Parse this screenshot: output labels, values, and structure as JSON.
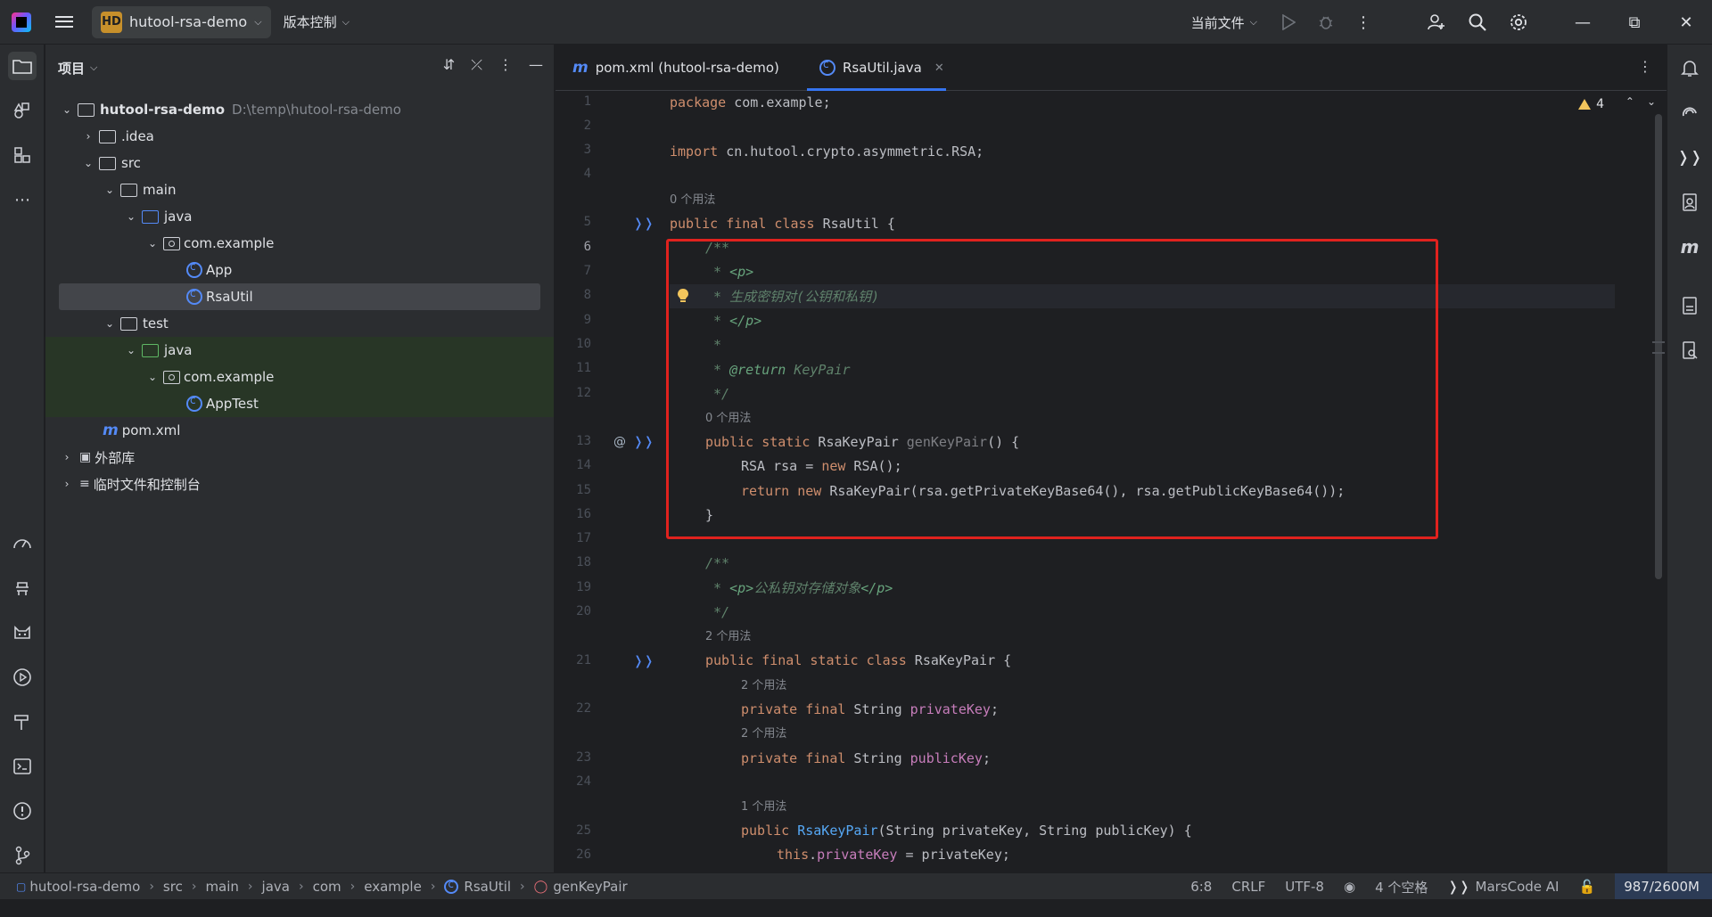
{
  "titlebar": {
    "project_badge": "HD",
    "project_name": "hutool-rsa-demo",
    "vcs_label": "版本控制",
    "run_config": "当前文件"
  },
  "project_panel": {
    "title": "项目",
    "tree": {
      "root_name": "hutool-rsa-demo",
      "root_path": "D:\\temp\\hutool-rsa-demo",
      "idea": ".idea",
      "src": "src",
      "main": "main",
      "java_main": "java",
      "pkg_main": "com.example",
      "app": "App",
      "rsautil": "RsaUtil",
      "test": "test",
      "java_test": "java",
      "pkg_test": "com.example",
      "apptest": "AppTest",
      "pom": "pom.xml",
      "ext_libs": "外部库",
      "scratches": "临时文件和控制台"
    }
  },
  "editor": {
    "tabs": [
      {
        "label": "pom.xml (hutool-rsa-demo)"
      },
      {
        "label": "RsaUtil.java"
      }
    ],
    "warning_count": "4",
    "hints": {
      "h0": "0 个用法",
      "h1": "0 个用法",
      "h2": "2 个用法",
      "h3": "2 个用法",
      "h4": "2 个用法",
      "h5": "1 个用法"
    },
    "line_numbers": [
      "1",
      "2",
      "3",
      "4",
      "5",
      "6",
      "7",
      "8",
      "9",
      "10",
      "11",
      "12",
      "13",
      "14",
      "15",
      "16",
      "17",
      "18",
      "19",
      "20",
      "21",
      "22",
      "23",
      "24",
      "25",
      "26"
    ],
    "code": {
      "l1_kw": "package",
      "l1_rest": " com.example;",
      "l3_kw": "import",
      "l3_rest": " cn.hutool.crypto.asymmetric.RSA;",
      "l5_kw": "public final class",
      "l5_name": " RsaUtil",
      "l5_rest": " {",
      "l6": "/**",
      "l7_star": " * ",
      "l7_tag": "<p>",
      "l8": " * 生成密钥对(公钥和私钥)",
      "l9_star": " * ",
      "l9_tag": "</p>",
      "l10": " *",
      "l11_star": " * ",
      "l11_tag": "@return",
      "l11_ref": " KeyPair",
      "l12": " */",
      "l13_kw": "public static",
      "l13_type": " RsaKeyPair ",
      "l13_fn": "genKeyPair",
      "l13_rest": "() {",
      "l14_a": "RSA rsa = ",
      "l14_kw": "new",
      "l14_b": " RSA();",
      "l15_kw": "return new",
      "l15_rest": " RsaKeyPair(rsa.getPrivateKeyBase64(), rsa.getPublicKeyBase64());",
      "l16": "}",
      "l18": "/**",
      "l19_star": " * ",
      "l19_tag": "<p>",
      "l19_text": "公私钥对存储对象",
      "l19_tag2": "</p>",
      "l20": " */",
      "l21_kw": "public final static class",
      "l21_rest": " RsaKeyPair {",
      "l22_kw": "private final",
      "l22_type": " String ",
      "l22_fld": "privateKey",
      "l22_end": ";",
      "l23_kw": "private final",
      "l23_type": " String ",
      "l23_fld": "publicKey",
      "l23_end": ";",
      "l25_kw": "public",
      "l25_fn": " RsaKeyPair",
      "l25_rest": "(String privateKey, String publicKey) {",
      "l26_kw": "this",
      "l26_dot": ".",
      "l26_fld": "privateKey",
      "l26_rest": " = privateKey;"
    }
  },
  "statusbar": {
    "crumbs": [
      "hutool-rsa-demo",
      "src",
      "main",
      "java",
      "com",
      "example",
      "RsaUtil",
      "genKeyPair"
    ],
    "position": "6:8",
    "line_sep": "CRLF",
    "encoding": "UTF-8",
    "indent": "4 个空格",
    "ai": "MarsCode AI",
    "memory": "987/2600M"
  },
  "colors": {
    "accent": "#3574f0",
    "highlight_box": "#e0221e",
    "keyword": "#cf8e6d",
    "doc_comment": "#5f826b",
    "field": "#c77dbb",
    "method": "#56a8f5"
  }
}
